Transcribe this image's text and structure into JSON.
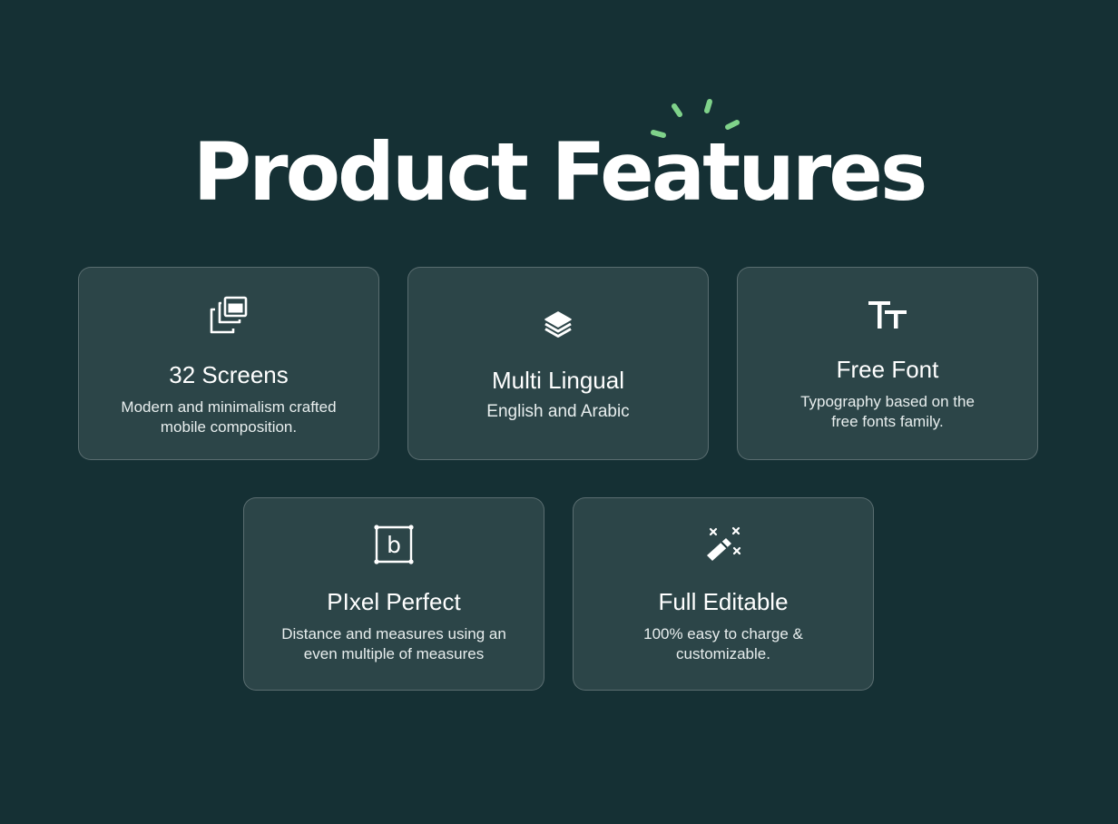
{
  "page": {
    "title": "Product Features",
    "background_color": "#153034",
    "accent_color": "#7fd28a"
  },
  "cards": [
    {
      "title": "32 Screens",
      "description_line1": "Modern and minimalism crafted",
      "description_line2": "mobile composition.",
      "icon": "screens-icon"
    },
    {
      "title": "Multi Lingual",
      "description_line1": "English and Arabic",
      "description_line2": "",
      "icon": "layers-icon"
    },
    {
      "title": "Free Font",
      "description_line1": "Typography based on the",
      "description_line2": "free fonts family.",
      "icon": "typography-icon"
    },
    {
      "title": "PIxel Perfect",
      "description_line1": "Distance and measures using an",
      "description_line2": "even multiple of measures",
      "icon": "bounding-box-icon",
      "icon_letter": "b"
    },
    {
      "title": "Full Editable",
      "description_line1": "100% easy to charge &",
      "description_line2": "customizable.",
      "icon": "magic-wand-icon"
    }
  ]
}
